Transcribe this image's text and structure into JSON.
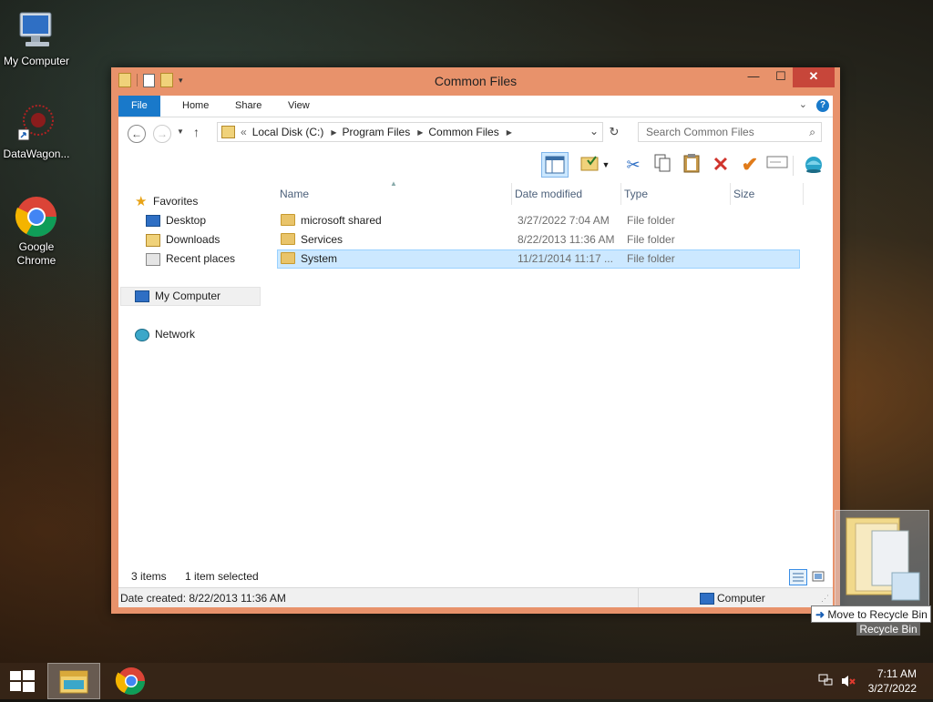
{
  "desktop": {
    "icons": [
      {
        "label": "My Computer"
      },
      {
        "label": "DataWagon..."
      },
      {
        "label": "Google Chrome"
      }
    ]
  },
  "window": {
    "title": "Common Files",
    "controls": {
      "minimize": "—",
      "maximize": "☐",
      "close": "✕"
    },
    "ribbon_tabs": [
      "File",
      "Home",
      "Share",
      "View"
    ],
    "address": {
      "prefix": "«",
      "segments": [
        "Local Disk (C:)",
        "Program Files",
        "Common Files"
      ]
    },
    "search_placeholder": "Search Common Files",
    "nav_pane": {
      "favorites": "Favorites",
      "favorite_items": [
        "Desktop",
        "Downloads",
        "Recent places"
      ],
      "computer": "My Computer",
      "network": "Network"
    },
    "columns": [
      "Name",
      "Date modified",
      "Type",
      "Size"
    ],
    "rows": [
      {
        "name": "microsoft shared",
        "date": "3/27/2022 7:04 AM",
        "type": "File folder",
        "size": ""
      },
      {
        "name": "Services",
        "date": "8/22/2013 11:36 AM",
        "type": "File folder",
        "size": ""
      },
      {
        "name": "System",
        "date": "11/21/2014 11:17 ...",
        "type": "File folder",
        "size": ""
      }
    ],
    "selected_row": 2,
    "status": {
      "items": "3 items",
      "selected": "1 item selected",
      "details": "Date created: 8/22/2013 11:36 AM",
      "location": "Computer"
    }
  },
  "drag": {
    "tooltip": "Move to Recycle Bin",
    "target_label": "Recycle Bin"
  },
  "taskbar": {
    "time": "7:11 AM",
    "date": "3/27/2022"
  },
  "colors": {
    "window_frame": "#e8926b",
    "accent": "#1979ca",
    "selection": "#cce8ff"
  }
}
